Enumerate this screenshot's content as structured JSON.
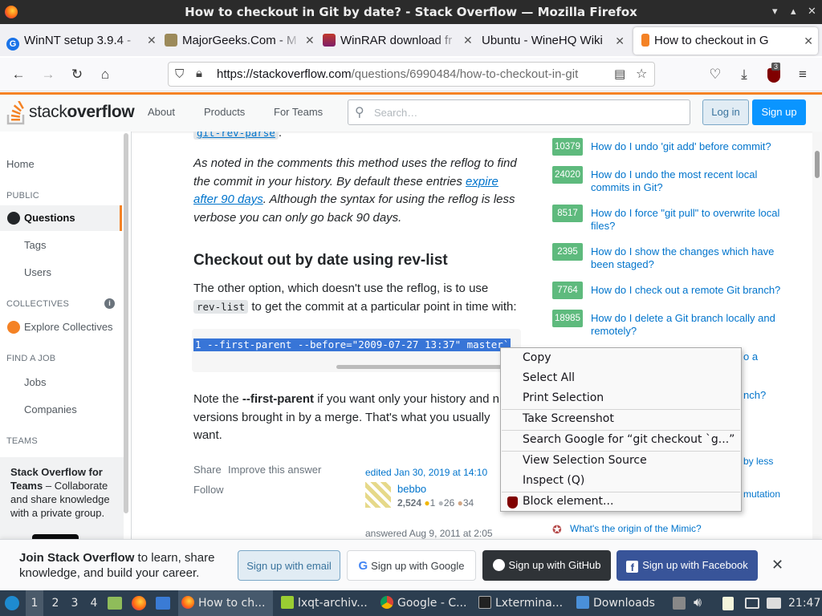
{
  "window": {
    "title": "How to checkout in Git by date? - Stack Overflow — Mozilla Firefox"
  },
  "tabs": [
    {
      "label": "WinNT setup 3.9.4 - ",
      "color": "#1a73e8"
    },
    {
      "label": "MajorGeeks.Com - M",
      "color": "#7a6a3a"
    },
    {
      "label": "WinRAR download fr",
      "color": "#8b1a1a"
    },
    {
      "label": "Ubuntu - WineHQ Wiki",
      "color": ""
    },
    {
      "label": "How to checkout in G",
      "color": "#f48225"
    }
  ],
  "urlbar": {
    "host": "https://stackoverflow.com",
    "path": "/questions/6990484/how-to-checkout-in-git",
    "ublock_count": "3"
  },
  "so_header": {
    "logo": "stackoverflow",
    "logo_stack": "stack",
    "logo_overflow": "overflow",
    "nav": [
      "About",
      "Products",
      "For Teams"
    ],
    "search_placeholder": "Search…",
    "login": "Log in",
    "signup": "Sign up"
  },
  "left_nav": {
    "home": "Home",
    "public_heading": "PUBLIC",
    "questions": "Questions",
    "tags": "Tags",
    "users": "Users",
    "collectives_heading": "COLLECTIVES",
    "explore_collectives": "Explore Collectives",
    "find_job_heading": "FIND A JOB",
    "jobs": "Jobs",
    "companies": "Companies",
    "teams_heading": "TEAMS",
    "teams_title": "Stack Overflow for Teams",
    "teams_text": " – Collaborate and share knowledge with a private group."
  },
  "answer": {
    "top_code": "git-rev-parse",
    "p1_a": "As noted in the comments this method uses the reflog to find the commit in your history. By default these entries ",
    "p1_link": "expire after 90 days",
    "p1_b": ". Although the syntax for using the reflog is less verbose you can only go back 90 days.",
    "heading": "Checkout out by date using rev-list",
    "p2_a": "The other option, which doesn't use the reflog, is to use",
    "p2_code": "rev-list",
    "p2_b": " to get the commit at a particular point in time with:",
    "code_line": "1 --first-parent --before=\"2009-07-27 13:37\" master`",
    "p3_a": "Note the ",
    "p3_bold": "--first-parent",
    "p3_b": " if you want only your history and n",
    "p3_c": "versions brought in by a merge. That's what you usually",
    "p3_d": "want.",
    "share": "Share",
    "improve": "Improve this answer",
    "follow": "Follow",
    "edited": "edited Jan 30, 2019 at 14:10",
    "editor_name": "bebbo",
    "editor_rep": "2,524",
    "gold": "1",
    "silver": "26",
    "bronze": "34",
    "answered": "answered Aug 9, 2011 at 2:05"
  },
  "hot_questions": [
    {
      "votes": "10379",
      "title": "How do I undo 'git add' before commit?"
    },
    {
      "votes": "24020",
      "title": "How do I undo the most recent local commits in Git?"
    },
    {
      "votes": "8517",
      "title": "How do I force \"git pull\" to overwrite local files?"
    },
    {
      "votes": "2395",
      "title": "How do I show the changes which have been staged?"
    },
    {
      "votes": "7764",
      "title": "How do I check out a remote Git branch?"
    },
    {
      "votes": "18985",
      "title": "How do I delete a Git branch locally and remotely?"
    }
  ],
  "side_fragments": {
    "f1": "o a",
    "f2": "nch?",
    "f3": "by less",
    "f4": "mutation",
    "mimic": "What's the origin of the Mimic?"
  },
  "context_menu": [
    {
      "label": "Copy"
    },
    {
      "label": "Select All"
    },
    {
      "label": "Print Selection"
    },
    {
      "label": "Take Screenshot"
    },
    {
      "label": "Search Google for “git checkout `g...”"
    },
    {
      "label": "View Selection Source"
    },
    {
      "label": "Inspect (Q)"
    },
    {
      "label": "Block element..."
    }
  ],
  "banner": {
    "join_bold": "Join Stack Overflow",
    "join_text": " to learn, share knowledge, and build your career.",
    "email": "Sign up with email",
    "google": "Sign up with Google",
    "github": "Sign up with GitHub",
    "facebook": "Sign up with Facebook"
  },
  "taskbar": {
    "desktops": [
      "1",
      "2",
      "3",
      "4"
    ],
    "windows": [
      "How to ch...",
      "lxqt-archiv...",
      "Google - C...",
      "Lxtermina...",
      "Downloads"
    ],
    "clock": "21:47"
  },
  "colors": {
    "so_orange": "#f48225",
    "so_blue": "#0a95ff",
    "link": "#0074cc",
    "vote_green": "#5eba7d",
    "selection": "#3875d7"
  }
}
